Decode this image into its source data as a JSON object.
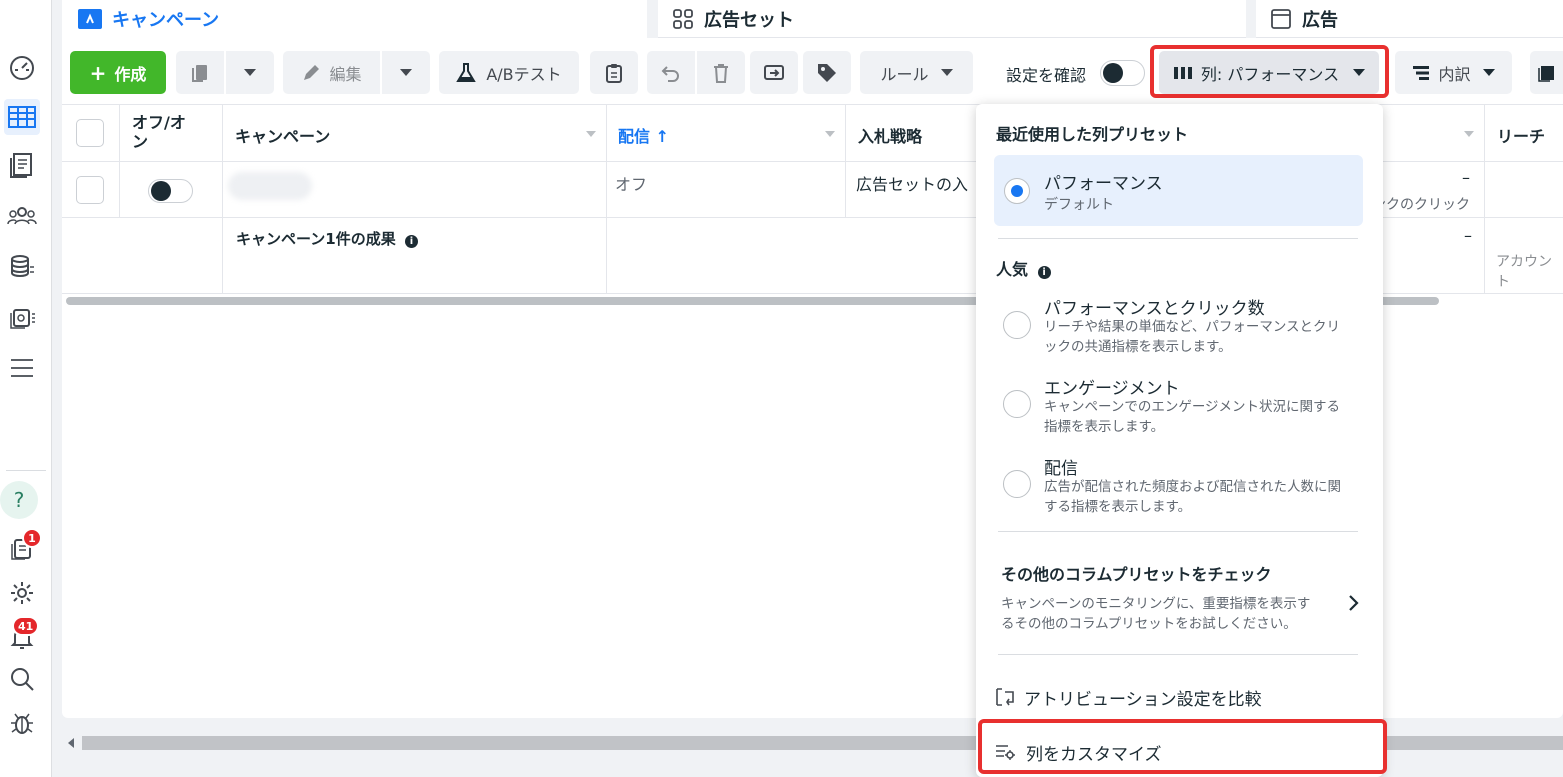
{
  "tabs": {
    "campaign": "キャンペーン",
    "adset": "広告セット",
    "ad": "広告"
  },
  "toolbar": {
    "create": "作成",
    "edit": "編集",
    "ab_test": "A/Bテスト",
    "rules": "ルール",
    "confirm_settings": "設定を確認",
    "columns": "列: パフォーマンス",
    "breakdown": "内訳"
  },
  "table": {
    "headers": {
      "toggle_line1": "オフ/オ",
      "toggle_line2": "ン",
      "campaign": "キャンペーン",
      "delivery": "配信 ↑",
      "bid_strategy": "入札戦略",
      "reach": "リーチ"
    },
    "row": {
      "delivery": "オフ",
      "bid_strategy": "広告セットの入",
      "dash": "–",
      "results_tail": "ンクのクリック"
    },
    "summary": {
      "label": "キャンペーン1件の成果",
      "dash": "–",
      "account_tail": "アカウント"
    }
  },
  "dropdown": {
    "recent_header": "最近使用した列プリセット",
    "selected": {
      "title": "パフォーマンス",
      "subtitle": "デフォルト"
    },
    "popular_header": "人気",
    "options": [
      {
        "title": "パフォーマンスとクリック数",
        "desc1": "リーチや結果の単価など、パフォーマンスとクリ",
        "desc2": "ックの共通指標を表示します。"
      },
      {
        "title": "エンゲージメント",
        "desc1": "キャンペーンでのエンゲージメント状況に関する",
        "desc2": "指標を表示します。"
      },
      {
        "title": "配信",
        "desc1": "広告が配信された頻度および配信された人数に関",
        "desc2": "する指標を表示します。"
      }
    ],
    "more_title": "その他のコラムプリセットをチェック",
    "more_desc1": "キャンペーンのモニタリングに、重要指標を表示す",
    "more_desc2": "るその他のコラムプリセットをお試しください。",
    "compare_attribution": "アトリビューション設定を比較",
    "customize": "列をカスタマイズ"
  },
  "badges": {
    "notifications": "1",
    "alerts": "41"
  },
  "colors": {
    "accent": "#1877f2",
    "create_green": "#42b72a",
    "highlight_red": "#e8302f"
  }
}
